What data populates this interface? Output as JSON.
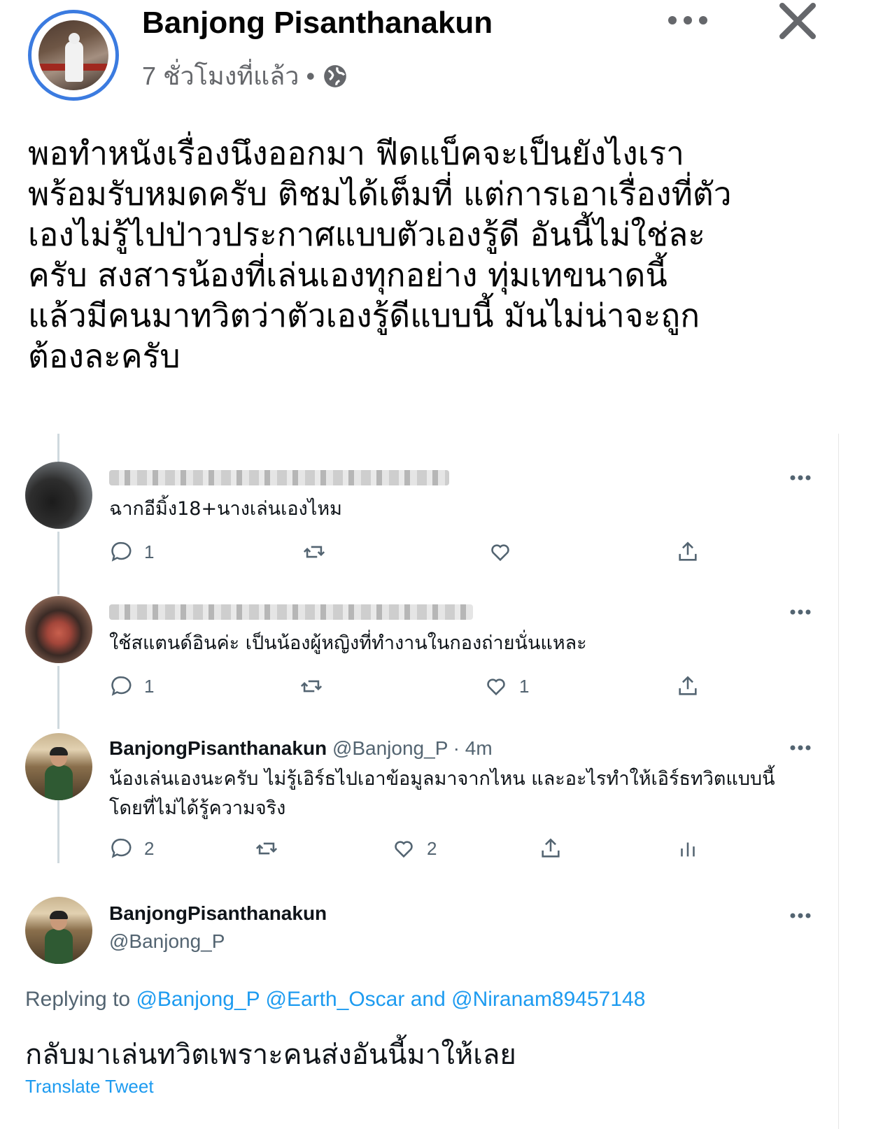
{
  "fb_post": {
    "author": "Banjong Pisanthanakun",
    "time": "7 ชั่วโมงที่แล้ว",
    "separator": "•",
    "text": "พอทำหนังเรื่องนึงออกมา ฟีดแบ็คจะเป็นยังไงเรา\nพร้อมรับหมดครับ ติชมได้เต็มที่ แต่การเอาเรื่องที่ตัว\nเองไม่รู้ไปป่าวประกาศแบบตัวเองรู้ดี อันนี้ไม่ใช่ละ\nครับ สงสารน้องที่เล่นเองทุกอย่าง ทุ่มเทขนาดนี้\nแล้วมีคนมาทวิตว่าตัวเองรู้ดีแบบนี้ มันไม่น่าจะถูก\nต้องละครับ"
  },
  "tweets": [
    {
      "text": "ฉากอีมิ้ง18+นางเล่นเองไหม",
      "replies": "1",
      "likes": ""
    },
    {
      "text": "ใช้สแตนด์อินค่ะ เป็นน้องผู้หญิงที่ทำงานในกองถ่ายนั่นแหละ",
      "replies": "1",
      "likes": "1"
    },
    {
      "name": "BanjongPisanthanakun",
      "handle": "@Banjong_P · 4m",
      "text_line1": "น้องเล่นเองนะครับ ไม่รู้เอิร์ธไปเอาข้อมูลมาจากไหน และอะไรทำให้เอิร์ธทวิตแบบนี้",
      "text_line2": "โดยที่ไม่ได้รู้ความจริง",
      "replies": "2",
      "likes": "2"
    }
  ],
  "main_tweet": {
    "name": "BanjongPisanthanakun",
    "handle": "@Banjong_P",
    "replying_prefix": "Replying to",
    "mention1": "@Banjong_P",
    "mention2": "@Earth_Oscar",
    "and": "and",
    "mention3": "@Niranam89457148",
    "text": "กลับมาเล่นทวิตเพราะคนส่งอันนี้มาให้เลย",
    "translate": "Translate Tweet"
  },
  "colors": {
    "fb_ring": "#3b7be0",
    "twitter_blue": "#1d9bf0",
    "muted": "#536471"
  }
}
